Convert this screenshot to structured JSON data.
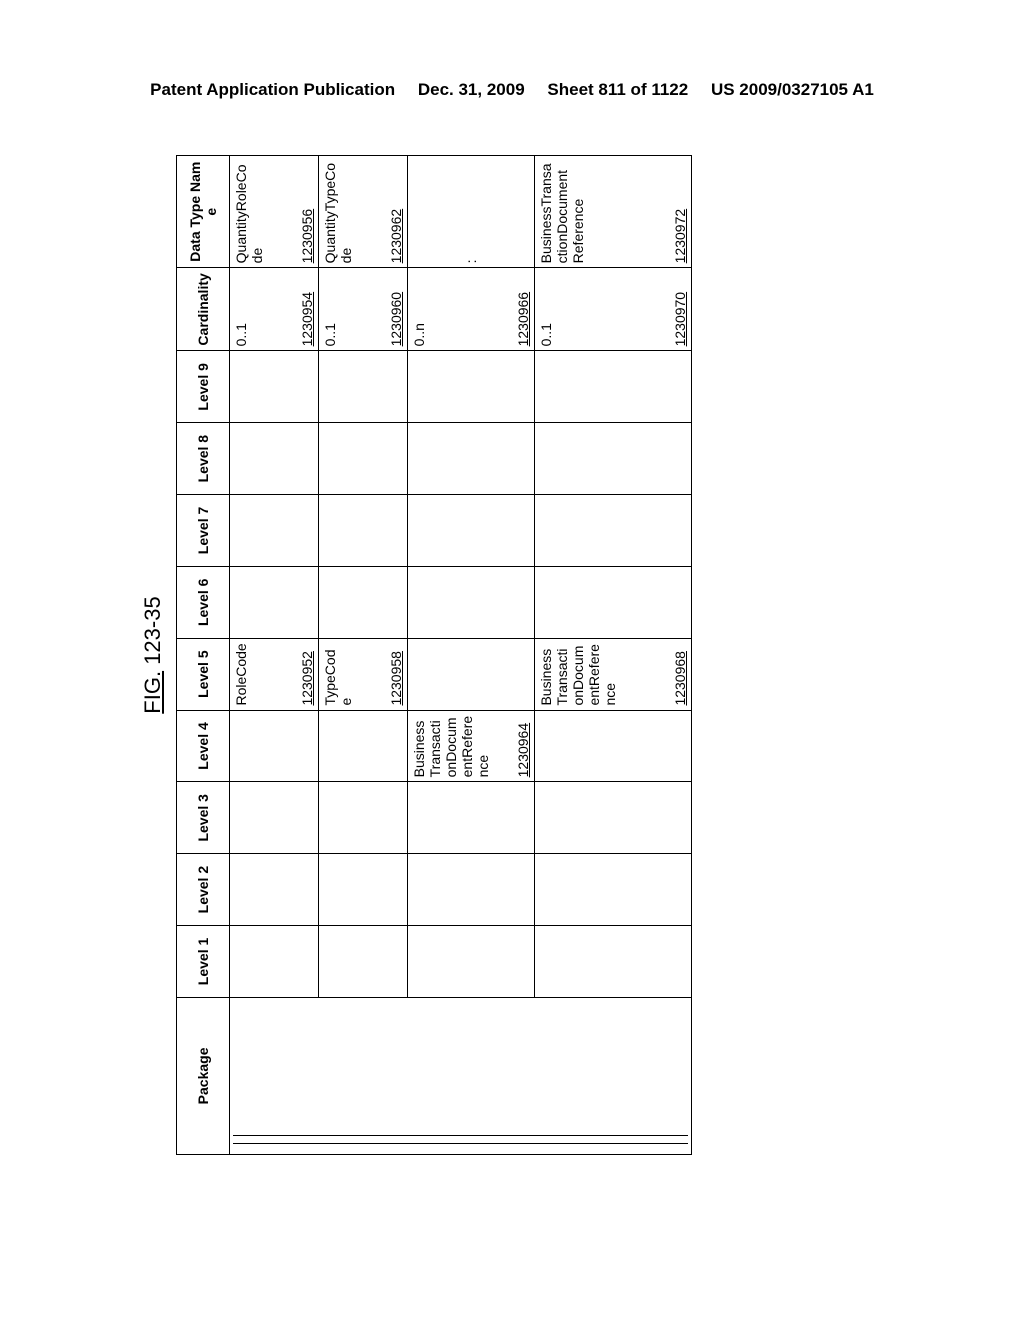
{
  "header": {
    "left": "Patent Application Publication",
    "mid": "Dec. 31, 2009",
    "sheet": "Sheet 811 of 1122",
    "right": "US 2009/0327105 A1"
  },
  "figure_label_prefix": "FIG.",
  "figure_label_number": " 123-35",
  "columns": {
    "package": "Package",
    "l1": "Level 1",
    "l2": "Level 2",
    "l3": "Level 3",
    "l4": "Level 4",
    "l5": "Level 5",
    "l6": "Level 6",
    "l7": "Level 7",
    "l8": "Level 8",
    "l9": "Level 9",
    "card": "Cardinality",
    "dtype": "Data Type Name"
  },
  "rows": [
    {
      "l5_text": "RoleCode",
      "l5_ref": "1230952",
      "card_text": "0..1",
      "card_ref": "1230954",
      "dtype_text": "QuantityRoleCode",
      "dtype_ref": "1230956"
    },
    {
      "l5_text": "TypeCode",
      "l5_ref": "1230958",
      "card_text": "0..1",
      "card_ref": "1230960",
      "dtype_text": "QuantityTypeCode",
      "dtype_ref": "1230962"
    },
    {
      "l4_text": "BusinessTransactionDocumentReference",
      "l4_ref": "1230964",
      "card_text": "0..n",
      "card_ref": "1230966",
      "dtype_text": ":"
    },
    {
      "l5_text": "BusinessTransactionDocumentReference",
      "l5_ref": "1230968",
      "card_text": "0..1",
      "card_ref": "1230970",
      "dtype_text": "BusinessTransactionDocumentReference",
      "dtype_ref": "1230972"
    }
  ]
}
